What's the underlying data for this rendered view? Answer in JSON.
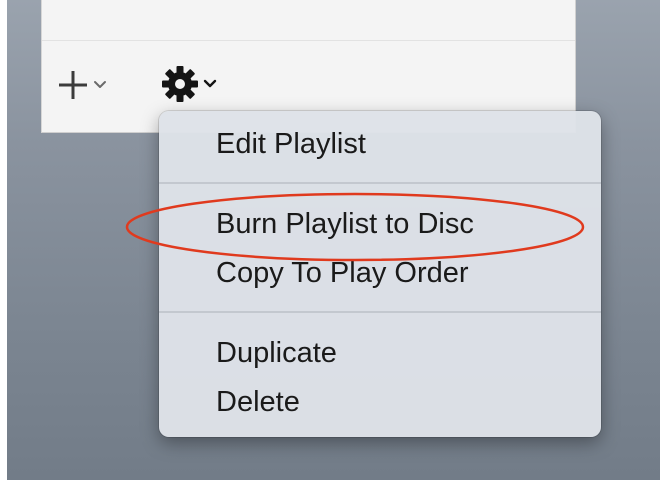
{
  "toolbar": {
    "add_icon": "plus-icon",
    "add_chevron_icon": "chevron-down-icon",
    "settings_icon": "gear-icon",
    "settings_chevron_icon": "chevron-down-icon"
  },
  "menu": {
    "items": [
      {
        "label": "Edit Playlist"
      },
      {
        "label": "Burn Playlist to Disc"
      },
      {
        "label": "Copy To Play Order"
      },
      {
        "label": "Duplicate"
      },
      {
        "label": "Delete"
      }
    ]
  },
  "colors": {
    "annotation": "#e03a1e",
    "backdrop": "#7f8995",
    "menu_bg": "#dee2e8",
    "text": "#1a1a1a"
  }
}
